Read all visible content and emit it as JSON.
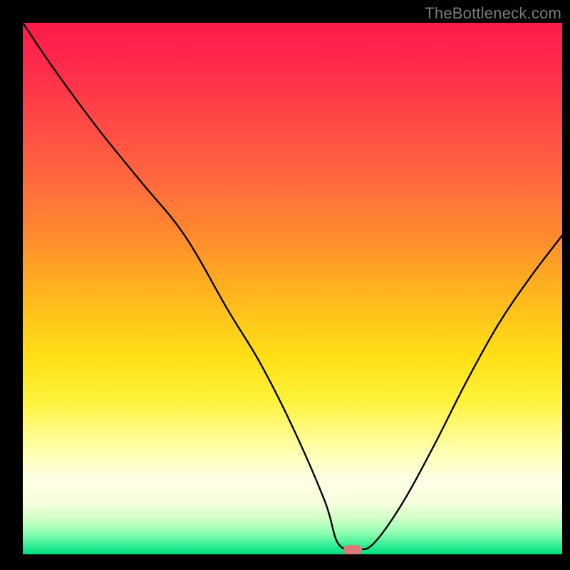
{
  "watermark": "TheBottleneck.com",
  "marker": {
    "color": "#d97a78",
    "x_frac": 0.611,
    "y_frac": 0.992
  },
  "chart_data": {
    "type": "line",
    "title": "",
    "xlabel": "",
    "ylabel": "",
    "xlim": [
      0,
      100
    ],
    "ylim": [
      0,
      100
    ],
    "grid": false,
    "series": [
      {
        "name": "curve",
        "x": [
          0,
          6,
          14,
          22,
          30,
          38,
          44,
          50,
          56,
          58.5,
          62,
          65,
          70,
          76,
          82,
          88,
          94,
          100
        ],
        "values": [
          100,
          91,
          80,
          70,
          60,
          46,
          36,
          24,
          10,
          2,
          1,
          2,
          9,
          20,
          32,
          43,
          52,
          60
        ]
      }
    ],
    "annotations": [
      {
        "type": "marker",
        "x": 61.1,
        "y": 0.8,
        "shape": "pill",
        "color": "#d97a78"
      }
    ],
    "background_gradient": {
      "orientation": "vertical",
      "stops": [
        {
          "pos": 0.0,
          "color": "#ff1a4d"
        },
        {
          "pos": 0.4,
          "color": "#ff8a2e"
        },
        {
          "pos": 0.63,
          "color": "#ffe016"
        },
        {
          "pos": 0.86,
          "color": "#ffffe6"
        },
        {
          "pos": 1.0,
          "color": "#00d97e"
        }
      ]
    }
  }
}
